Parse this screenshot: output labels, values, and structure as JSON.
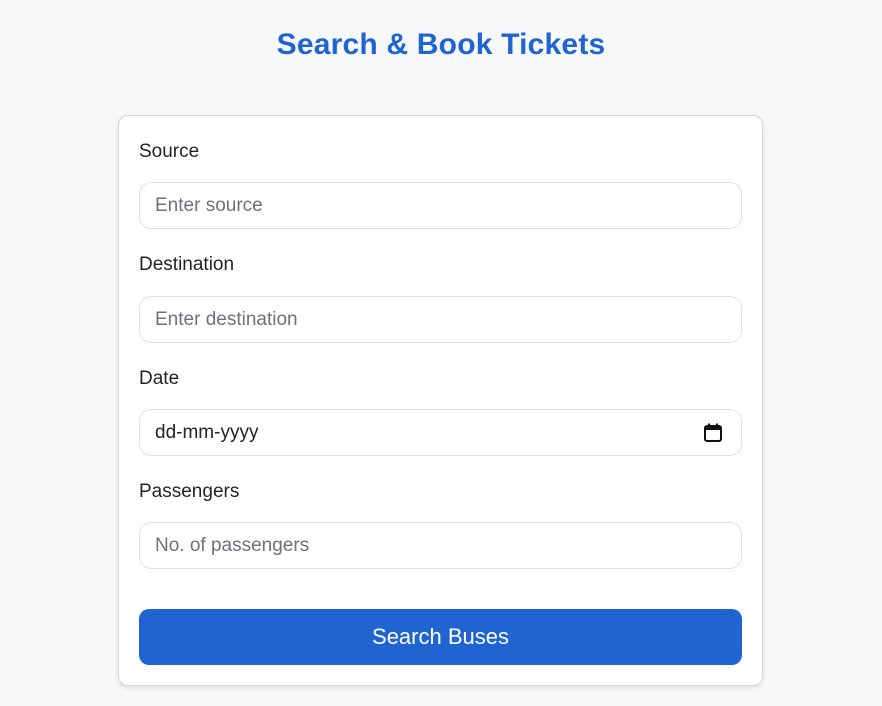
{
  "page": {
    "title": "Search & Book Tickets"
  },
  "form": {
    "source": {
      "label": "Source",
      "placeholder": "Enter source",
      "value": ""
    },
    "destination": {
      "label": "Destination",
      "placeholder": "Enter destination",
      "value": ""
    },
    "date": {
      "label": "Date",
      "display": "dd-mm-yyyy",
      "icon": "calendar-icon"
    },
    "passengers": {
      "label": "Passengers",
      "placeholder": "No. of passengers",
      "value": ""
    },
    "submit_label": "Search Buses"
  },
  "colors": {
    "accent": "#1f64d0",
    "background": "#f7f8fa",
    "card": "#ffffff"
  }
}
